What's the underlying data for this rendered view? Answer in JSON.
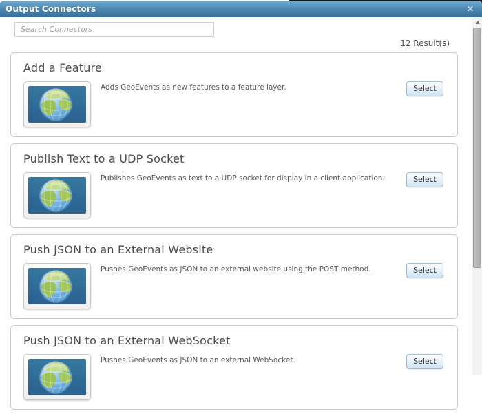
{
  "dialog": {
    "title": "Output Connectors",
    "close_icon": "✕"
  },
  "search": {
    "placeholder": "Search Connectors"
  },
  "results": {
    "count_label": "12 Result(s)"
  },
  "connectors": [
    {
      "title": "Add a Feature",
      "description": "Adds GeoEvents as new features to a feature layer.",
      "select_label": "Select"
    },
    {
      "title": "Publish Text to a UDP Socket",
      "description": "Publishes GeoEvents as text to a UDP socket for display in a client application.",
      "select_label": "Select"
    },
    {
      "title": "Push JSON to an External Website",
      "description": "Pushes GeoEvents as JSON to an external website using the POST method.",
      "select_label": "Select"
    },
    {
      "title": "Push JSON to an External WebSocket",
      "description": "Pushes GeoEvents as JSON to an external WebSocket.",
      "select_label": "Select"
    }
  ],
  "colors": {
    "titlebar_gradient_top": "#6ea8cd",
    "titlebar_gradient_bottom": "#3a7099",
    "titlebar_text": "#ffffff",
    "card_border": "#c9c9c9",
    "button_border": "#a0b8cc",
    "button_gradient_bottom": "#cde3f3",
    "thumbnail_background": "#31729f",
    "globe_land": "#a4c75c",
    "globe_ocean": "#79b9e6"
  }
}
